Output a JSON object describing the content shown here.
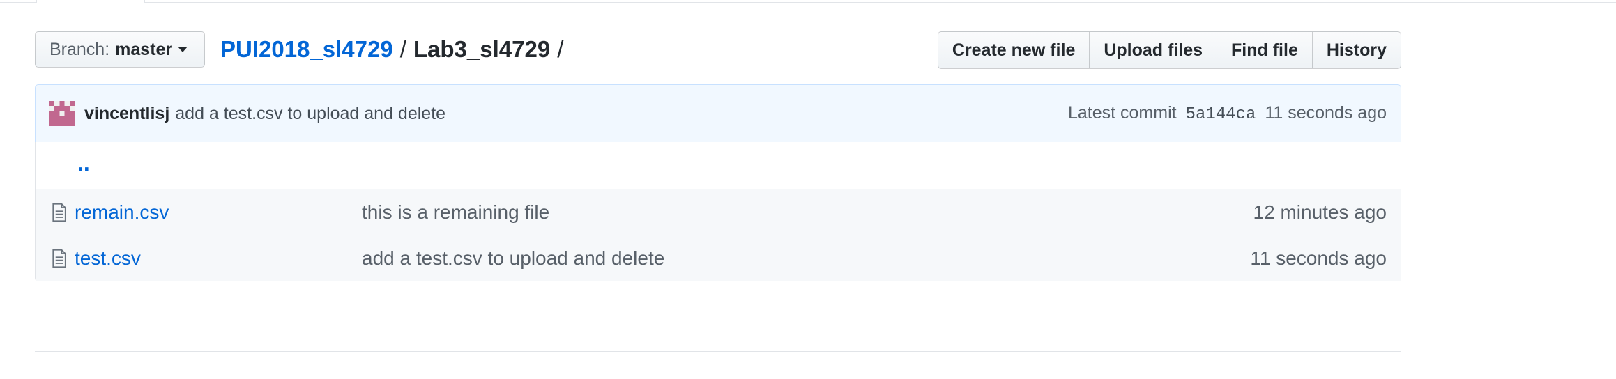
{
  "branch": {
    "prefix": "Branch:",
    "name": "master"
  },
  "breadcrumb": {
    "repo": "PUI2018_sl4729",
    "separator": "/",
    "folder": "Lab3_sl4729",
    "trailing": "/"
  },
  "actions": {
    "create_new_file": "Create new file",
    "upload_files": "Upload files",
    "find_file": "Find file",
    "history": "History"
  },
  "commit": {
    "author": "vincentlisj",
    "message": "add a test.csv to upload and delete",
    "latest_label": "Latest commit",
    "sha": "5a144ca",
    "age": "11 seconds ago",
    "avatar_color": "#c1688f"
  },
  "files": {
    "up_link": "..",
    "rows": [
      {
        "name": "remain.csv",
        "message": "this is a remaining file",
        "age": "12 minutes ago"
      },
      {
        "name": "test.csv",
        "message": "add a test.csv to upload and delete",
        "age": "11 seconds ago"
      }
    ]
  },
  "colors": {
    "link": "#0366d6",
    "commit_bg": "#f1f8ff",
    "commit_border": "#c8e1ff"
  },
  "icons": {
    "caret": "caret-down-icon",
    "file": "file-text-icon",
    "avatar": "identicon-avatar"
  }
}
